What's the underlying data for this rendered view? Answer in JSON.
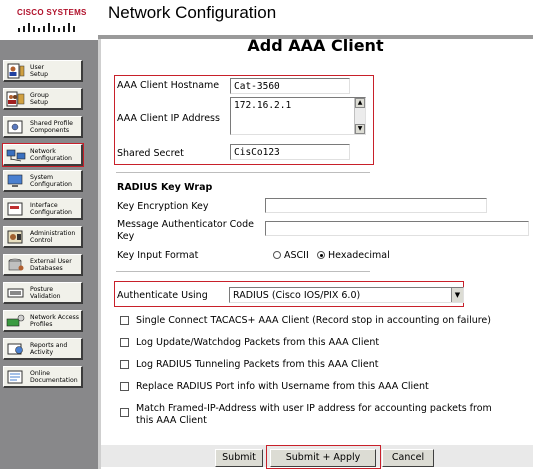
{
  "brand": {
    "name": "Cisco Systems"
  },
  "header": {
    "title": "Network Configuration"
  },
  "sidebar": {
    "items": [
      {
        "label_1": "User",
        "label_2": "Setup",
        "icon": "user-setup-icon"
      },
      {
        "label_1": "Group",
        "label_2": "Setup",
        "icon": "group-setup-icon"
      },
      {
        "label_1": "Shared Profile",
        "label_2": "Components",
        "icon": "shared-profile-icon"
      },
      {
        "label_1": "Network",
        "label_2": "Configuration",
        "icon": "network-config-icon"
      },
      {
        "label_1": "System",
        "label_2": "Configuration",
        "icon": "system-config-icon"
      },
      {
        "label_1": "Interface",
        "label_2": "Configuration",
        "icon": "interface-config-icon"
      },
      {
        "label_1": "Administration",
        "label_2": "Control",
        "icon": "admin-control-icon"
      },
      {
        "label_1": "External User",
        "label_2": "Databases",
        "icon": "external-db-icon"
      },
      {
        "label_1": "Posture",
        "label_2": "Validation",
        "icon": "posture-icon"
      },
      {
        "label_1": "Network Access",
        "label_2": "Profiles",
        "icon": "nap-icon"
      },
      {
        "label_1": "Reports and",
        "label_2": "Activity",
        "icon": "reports-icon"
      },
      {
        "label_1": "Online",
        "label_2": "Documentation",
        "icon": "docs-icon"
      }
    ]
  },
  "form": {
    "title": "Add AAA Client",
    "hostname_label": "AAA Client Hostname",
    "hostname_value": "Cat-3560",
    "ip_label": "AAA Client IP Address",
    "ip_value": "172.16.2.1",
    "secret_label": "Shared Secret",
    "secret_value": "CisCo123",
    "keywrap_heading": "RADIUS Key Wrap",
    "kek_label": "Key Encryption Key",
    "mack_label_1": "Message Authenticator Code",
    "mack_label_2": "Key",
    "input_format_label": "Key Input Format",
    "ascii_label": "ASCII",
    "hex_label": "Hexadecimal",
    "auth_label": "Authenticate Using",
    "auth_value": "RADIUS (Cisco IOS/PIX 6.0)",
    "opt_single_connect": "Single Connect TACACS+ AAA Client (Record stop in accounting on failure)",
    "opt_log_update": "Log Update/Watchdog Packets from this AAA Client",
    "opt_log_tunnel": "Log RADIUS Tunneling Packets from this AAA Client",
    "opt_replace_port": "Replace RADIUS Port info with Username from this AAA Client",
    "opt_match_ip_1": "Match Framed-IP-Address with user IP address for accounting packets from",
    "opt_match_ip_2": "this AAA Client"
  },
  "buttons": {
    "submit": "Submit",
    "submit_apply": "Submit + Apply",
    "cancel": "Cancel"
  },
  "colors": {
    "highlight": "#c8202a",
    "sidebar": "#88888a"
  }
}
